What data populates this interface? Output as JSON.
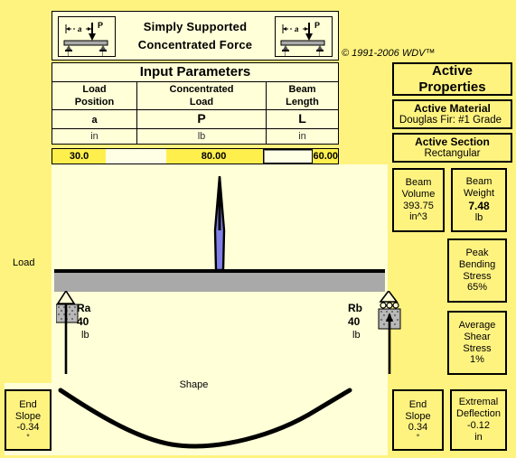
{
  "header": {
    "title_line1": "Simply Supported",
    "title_line2": "Concentrated Force",
    "icon_left": "beam-diagram-icon",
    "icon_right": "beam-diagram-icon",
    "icon_label_a": "a",
    "icon_label_p": "P",
    "copyright": "© 1991-2006 WDV™"
  },
  "input_panel": {
    "title": "Input Parameters",
    "columns": [
      {
        "header_line1": "Load",
        "header_line2": "Position",
        "symbol": "a",
        "unit": "in",
        "value": "30.0"
      },
      {
        "header_line1": "Concentrated",
        "header_line2": "Load",
        "symbol": "P",
        "unit": "lb",
        "value": "80.00"
      },
      {
        "header_line1": "Beam",
        "header_line2": "Length",
        "symbol": "L",
        "unit": "in",
        "value": "60.00"
      }
    ],
    "empty_field_value": ""
  },
  "sidebar": {
    "title_line1": "Active",
    "title_line2": "Properties",
    "material": {
      "label": "Active Material",
      "value": "Douglas Fir: #1 Grade"
    },
    "section": {
      "label": "Active Section",
      "value": "Rectangular"
    },
    "beam_volume": {
      "label_line1": "Beam",
      "label_line2": "Volume",
      "value": "393.75",
      "unit": "in^3"
    },
    "beam_weight": {
      "label_line1": "Beam",
      "label_line2": "Weight",
      "value": "7.48",
      "unit": "lb"
    },
    "peak_bending_stress": {
      "label_line1": "Peak",
      "label_line2": "Bending",
      "label_line3": "Stress",
      "value": "65%"
    },
    "average_shear_stress": {
      "label_line1": "Average",
      "label_line2": "Shear",
      "label_line3": "Stress",
      "value": "1%"
    }
  },
  "results": {
    "end_slope_left": {
      "label_line1": "End",
      "label_line2": "Slope",
      "value": "-0.34",
      "unit": "°"
    },
    "end_slope_right": {
      "label_line1": "End",
      "label_line2": "Slope",
      "value": "0.34",
      "unit": "°"
    },
    "extremal_deflection": {
      "label_line1": "Extremal",
      "label_line2": "Deflection",
      "value": "-0.12",
      "unit": "in"
    }
  },
  "diagram": {
    "load_label": "Load",
    "shape_label": "Shape",
    "reaction_a": {
      "name": "Ra",
      "value": "40",
      "unit": "lb"
    },
    "reaction_b": {
      "name": "Rb",
      "value": "40",
      "unit": "lb"
    },
    "load_arrow_icon": "load-spike-icon",
    "support_left_icon": "pin-support-icon",
    "support_right_icon": "roller-support-icon"
  },
  "colors": {
    "window_background": "#FFF380",
    "panel_background": "#FFFFD8",
    "input_highlight": "#FFEF4D",
    "beam_gray": "#A9A9A9",
    "load_blue": "#8080E8",
    "border": "#000000"
  }
}
